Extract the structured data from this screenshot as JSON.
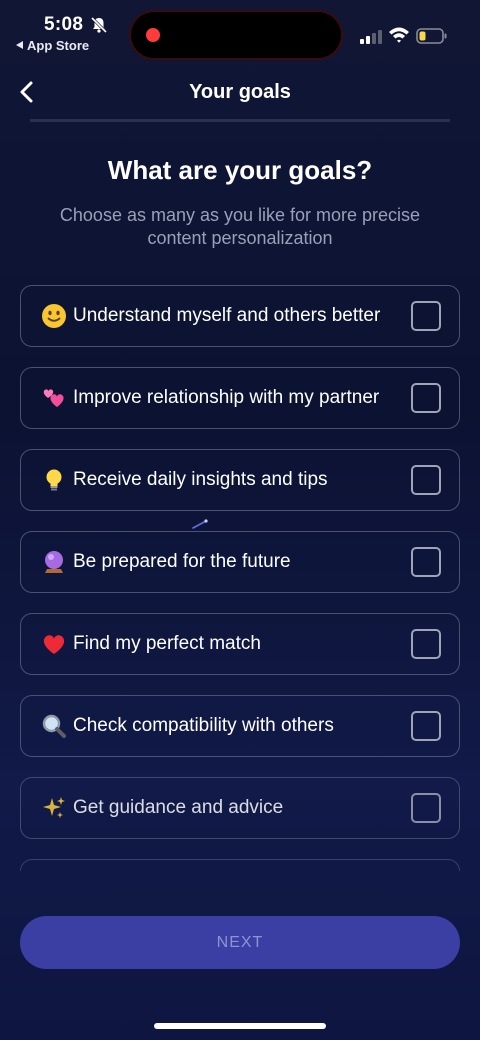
{
  "status_bar": {
    "time": "5:08",
    "back_app_label": "App Store",
    "icons": [
      "bell-off-icon",
      "record-dot",
      "signal-icon",
      "wifi-icon",
      "battery-icon"
    ],
    "colors": {
      "record_dot": "#ff3b3b",
      "battery": "#f6d84a"
    }
  },
  "header": {
    "back_icon": "chevron-left-icon",
    "title": "Your goals"
  },
  "main": {
    "heading": "What are your goals?",
    "subheading": "Choose as many as you like for more precise content personalization"
  },
  "options": [
    {
      "emoji": "slightly-smiling-face-icon",
      "label": "Understand myself and others better",
      "checked": false
    },
    {
      "emoji": "two-hearts-icon",
      "label": "Improve relationship with my partner",
      "checked": false
    },
    {
      "emoji": "light-bulb-icon",
      "label": "Receive daily insights and tips",
      "checked": false
    },
    {
      "emoji": "crystal-ball-icon",
      "label": "Be prepared for the future",
      "checked": false
    },
    {
      "emoji": "red-heart-icon",
      "label": "Find my perfect match",
      "checked": false
    },
    {
      "emoji": "magnifying-glass-icon",
      "label": "Check compatibility with others",
      "checked": false
    },
    {
      "emoji": "sparkles-icon",
      "label": "Get guidance and advice",
      "checked": false
    }
  ],
  "footer": {
    "next_label": "NEXT"
  },
  "colors": {
    "background": "#0c1232",
    "button": "#3b3fa3",
    "button_text": "#8f93cf",
    "card_border": "#4b5270",
    "subtext": "#9aa0b7"
  }
}
